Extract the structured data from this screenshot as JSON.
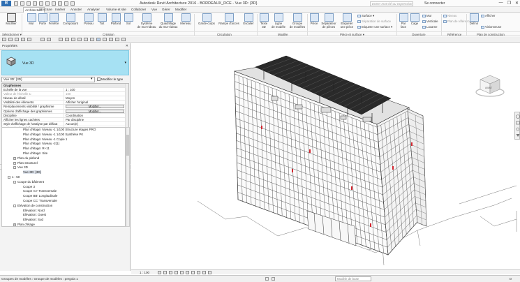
{
  "app": {
    "badge": "R",
    "title": "Autodesk Revit Architecture 2016 -   BORDEAUX_DCE - Vue 3D: {3D}"
  },
  "search": {
    "placeholder": "Entrer mot-clé ou expression"
  },
  "account": {
    "login_label": "Se connecter"
  },
  "window_controls": {
    "minimize": "—",
    "restore": "❐",
    "close": "✕"
  },
  "tabs": [
    "Architecture",
    "Structure",
    "Insérer",
    "Annoter",
    "Analyser",
    "Volume et site",
    "Collaborer",
    "Vue",
    "Gérer",
    "Modifier"
  ],
  "ribbon": {
    "buttons": {
      "modifier": "Modifier",
      "mur": "Mur",
      "porte": "Porte",
      "fenetre": "Fenêtre",
      "composant": "Composant",
      "poteau": "Poteau",
      "toit": "Toit",
      "plafond": "Plafond",
      "sol": "Sol",
      "systeme_mur_rideau": "Système\nde mur-rideau",
      "quadrillage_mur_rideau": "Quadrillage\ndu mur-rideau",
      "meneau": "Meneau",
      "garde_corps": "Garde-corps",
      "rampe_acces": "Rampe d'accès",
      "escalier": "Escalier",
      "texte_3d": "Texte\n3D",
      "ligne_modele": "Ligne\nde modèle",
      "groupe_modeles": "Groupe\nde modèles",
      "piece": "Pièce",
      "separateur_pieces": "Séparateur\nde pièces",
      "etiqueter_piece": "Etiqueter\nune pièce",
      "par_face": "Par\nface",
      "cage": "Cage",
      "definir": "Définir"
    },
    "small": {
      "surface": "Surface ▾",
      "separation_surface": "Séparation de surface",
      "etiqueter_surface": "Etiqueter une surface ▾",
      "mur": "Mur",
      "verticale": "Verticale",
      "lucarne": "Lucarne",
      "niveau": "Niveau",
      "plan_reference": "Plan de référence",
      "afficher": "Afficher",
      "visionneuse": "Visionneuse"
    },
    "panels": {
      "selectionner": "Sélectionner ▾",
      "creation": "Création",
      "circulation": "Circulation",
      "modele": "Modèle",
      "piece_surface": "Pièce et surface ▾",
      "ouverture": "Ouverture",
      "reference": "Référence",
      "plan_construction": "Plan de construction"
    }
  },
  "properties": {
    "title": "Propriétés",
    "close": "✕",
    "type_name": "Vue 3D",
    "instance": "Vue 3D: {3D}",
    "dropdown": "▾",
    "edit_type": "Modifier le type",
    "rows": [
      {
        "k": "Graphismes",
        "v": "",
        "kind": "section"
      },
      {
        "k": "Echelle de la vue",
        "v": "1 : 100",
        "kind": "value"
      },
      {
        "k": "Valeur de l'échelle    1:",
        "v": "100",
        "kind": "dim"
      },
      {
        "k": "Niveau de détail",
        "v": "Moyen",
        "kind": "value"
      },
      {
        "k": "Visibilité des éléments",
        "v": "Afficher l'original",
        "kind": "value"
      },
      {
        "k": "Remplacements visibilité / graphisme",
        "v": "Modifier...",
        "kind": "button"
      },
      {
        "k": "Options d'affichage des graphismes",
        "v": "Modifier...",
        "kind": "button"
      },
      {
        "k": "Discipline",
        "v": "Coordination",
        "kind": "value"
      },
      {
        "k": "Afficher les lignes cachées",
        "v": "Par discipline",
        "kind": "value"
      },
      {
        "k": "Style d'affichage de l'analyse par défaut",
        "v": "Aucun(e)",
        "kind": "value"
      },
      {
        "k": "Trajectoire du soleil",
        "v": "",
        "kind": "check"
      },
      {
        "k": "Texte",
        "v": "",
        "kind": "section"
      },
      {
        "k": "RGT",
        "v": "",
        "kind": "value"
      },
      {
        "k": "Etendues",
        "v": "",
        "kind": "section"
      },
      {
        "k": "Cadrer la vue",
        "v": "",
        "kind": "check"
      },
      {
        "k": "Cadrage visible",
        "v": "",
        "kind": "check"
      },
      {
        "k": "Zone cadrée",
        "v": "",
        "kind": "dim"
      }
    ],
    "help_link": "Aide des propriétés",
    "apply": "Appliquer"
  },
  "browser": {
    "title": "Arborescence du projet - BORDEAUX_DCE",
    "close": "✕",
    "items": [
      {
        "label": "Plan d'étage: Niveau -1 1/100 Structure étages PRO",
        "indent": 3,
        "toggle": ""
      },
      {
        "label": "Plan d'étage: Niveau -1 1/100 Synthèse PK",
        "indent": 3,
        "toggle": ""
      },
      {
        "label": "Plan d'étage: Niveau -1 Copie 1",
        "indent": 3,
        "toggle": ""
      },
      {
        "label": "Plan d'étage: Niveau -2(1)",
        "indent": 3,
        "toggle": ""
      },
      {
        "label": "Plan d'étage: R+11",
        "indent": 3,
        "toggle": ""
      },
      {
        "label": "Plan d'étage: Site",
        "indent": 3,
        "toggle": ""
      },
      {
        "label": "Plan du plafond",
        "indent": 2,
        "toggle": "+"
      },
      {
        "label": "Plan structurel",
        "indent": 2,
        "toggle": "+"
      },
      {
        "label": "Vue 3D",
        "indent": 2,
        "toggle": "-"
      },
      {
        "label": "Vue 3D: {3D}",
        "indent": 3,
        "toggle": "",
        "selected": true
      },
      {
        "label": "1 : 50",
        "indent": 1,
        "toggle": "-"
      },
      {
        "label": "Coupe du bâtiment",
        "indent": 2,
        "toggle": "-"
      },
      {
        "label": "Coupe 3",
        "indent": 3,
        "toggle": ""
      },
      {
        "label": "Coupe AA' Transversale",
        "indent": 3,
        "toggle": ""
      },
      {
        "label": "Coupe BB' Longitudinale",
        "indent": 3,
        "toggle": ""
      },
      {
        "label": "Coupe CC' Transversale",
        "indent": 3,
        "toggle": ""
      },
      {
        "label": "Elévation de construction",
        "indent": 2,
        "toggle": "-"
      },
      {
        "label": "Elévation: Nord",
        "indent": 3,
        "toggle": ""
      },
      {
        "label": "Elévation: Ouest",
        "indent": 3,
        "toggle": ""
      },
      {
        "label": "Elévation: Sud",
        "indent": 3,
        "toggle": ""
      },
      {
        "label": "Plan d'étage",
        "indent": 2,
        "toggle": "+"
      }
    ]
  },
  "viewcube": {
    "face": "AVANT"
  },
  "viewbar": {
    "scale": "1 : 100"
  },
  "status": {
    "text": "Groupes de modèles : Groupe de modèles : pergola 1",
    "model_field": "Modèle de base",
    "filter": ":0"
  }
}
